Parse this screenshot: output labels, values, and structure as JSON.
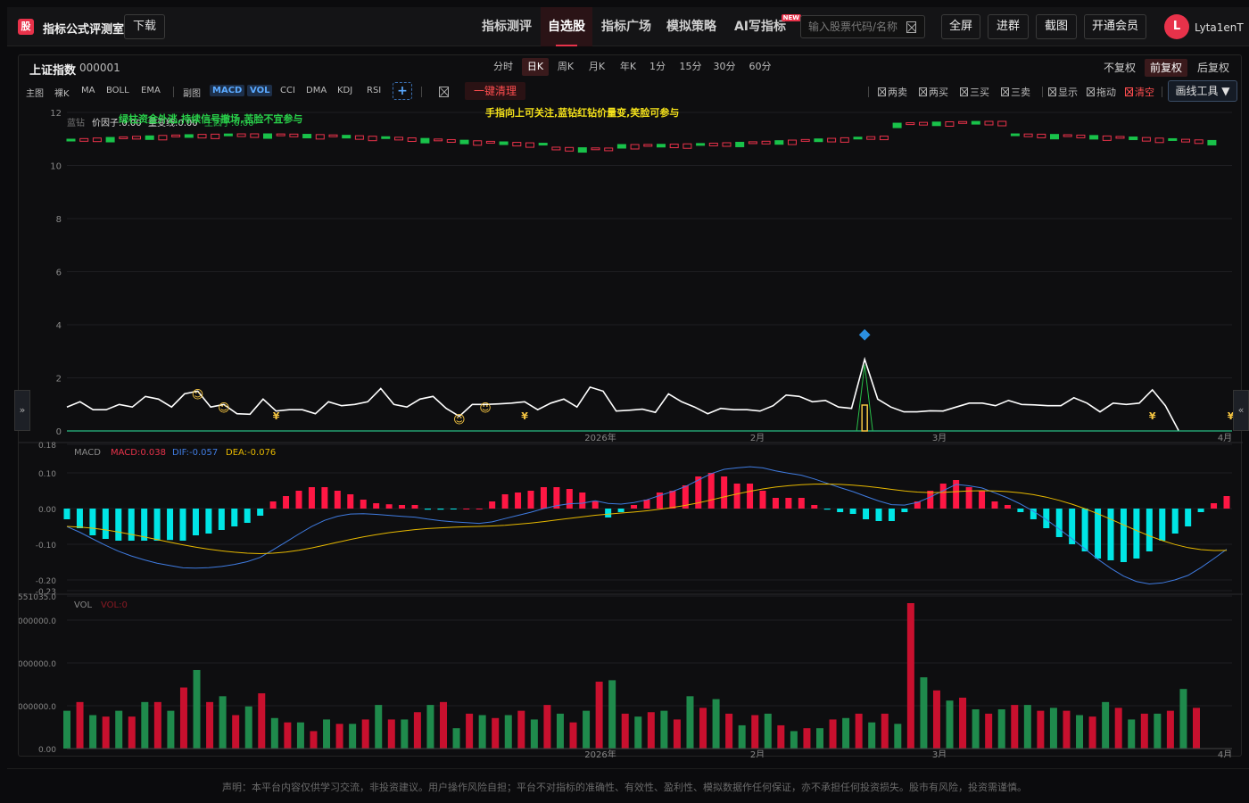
{
  "app": {
    "logo_char": "股",
    "title": "指标公式评测室",
    "download": "下载"
  },
  "nav": [
    {
      "label": "指标测评"
    },
    {
      "label": "自选股",
      "active": true
    },
    {
      "label": "指标广场"
    },
    {
      "label": "模拟策略"
    },
    {
      "label": "AI写指标",
      "badge": "NEW"
    }
  ],
  "search": {
    "placeholder": "输入股票代码/名称"
  },
  "top_buttons": [
    "全屏",
    "进群",
    "截图",
    "开通会员"
  ],
  "user": {
    "avatar": "L",
    "name": "Lyta1enT"
  },
  "stock": {
    "name": "上证指数",
    "code": "000001"
  },
  "periods": [
    "分时",
    "日K",
    "周K",
    "月K",
    "年K",
    "1分",
    "15分",
    "30分",
    "60分"
  ],
  "active_period": "日K",
  "adjust": [
    "不复权",
    "前复权",
    "后复权"
  ],
  "active_adjust": "前复权",
  "tools": {
    "main_label": "主图",
    "main": [
      "裸K",
      "MA",
      "BOLL",
      "EMA"
    ],
    "sub_label": "副图",
    "sub": [
      "MACD",
      "VOL",
      "CCI",
      "DMA",
      "KDJ",
      "RSI"
    ],
    "active_sub": [
      "MACD",
      "VOL"
    ],
    "plus": "+",
    "clear": "一键清理",
    "checks": [
      "两卖",
      "两买",
      "三买",
      "三卖",
      "显示",
      "拖动",
      "清空"
    ],
    "draw_tool": "画线工具 ▼"
  },
  "indicator_text": {
    "legend_name": "蓝钻",
    "price_factor": "价因子:0.00",
    "volume_line": "量变线:0.00",
    "green_factor": "主因子:0.00",
    "note_green": "绿柱资金外逃,持续信号撤场,苦脸不宜参与",
    "note_yellow": "手指向上可关注,蓝钻红钻价量变,笑脸可参与"
  },
  "side": {
    "left": "»",
    "right": "«"
  },
  "disclaimer": "声明：本平台内容仅供学习交流，非投资建议。用户操作风险自担；平台不对指标的准确性、有效性、盈利性、模拟数据作任何保证，亦不承担任何投资损失。股市有风险，投资需谨慎。",
  "chart_data": [
    {
      "type": "line",
      "title": "",
      "ylim": [
        0,
        12
      ],
      "y_ticks": [
        0,
        2,
        4,
        6,
        8,
        10,
        12
      ],
      "x_tick_labels": [
        "2026年",
        "2月",
        "3月",
        "4月"
      ],
      "series": [
        {
          "name": "",
          "color": "#ffffff",
          "values": [
            0.9,
            1.1,
            0.8,
            0.8,
            1.0,
            0.9,
            1.3,
            1.2,
            0.9,
            1.4,
            1.5,
            0.9,
            1.0,
            0.65,
            0.63,
            1.2,
            0.75,
            0.8,
            0.8,
            0.65,
            1.1,
            0.95,
            1.0,
            1.1,
            1.6,
            1.0,
            0.9,
            1.2,
            1.3,
            0.85,
            0.55,
            1.0,
            1.0,
            1.02,
            1.05,
            1.1,
            0.8,
            1.05,
            1.2,
            0.9,
            1.65,
            1.5,
            0.75,
            0.78,
            0.82,
            0.7,
            1.4,
            1.1,
            0.9,
            0.65,
            0.85,
            0.8,
            0.8,
            0.75,
            0.95,
            1.35,
            1.3,
            1.1,
            1.15,
            0.9,
            0.85,
            2.7,
            1.2,
            0.9,
            0.72,
            0.72,
            0.76,
            0.75,
            0.9,
            1.05,
            1.05,
            0.95,
            1.15,
            1.0,
            0.98,
            0.95,
            0.95,
            1.25,
            1.05,
            0.72,
            1.05,
            1.0,
            1.05,
            1.55,
            0.95,
            0.02
          ]
        },
        {
          "name": "",
          "color": "#f5c542",
          "style": "candles",
          "note": "price candles near top"
        }
      ],
      "markers": {
        "smile_indices": [
          10,
          12,
          30,
          32
        ],
        "yen_indices": [
          16,
          35,
          83,
          89
        ],
        "diamond_index": 61
      }
    },
    {
      "type": "bar",
      "title": "MACD",
      "labels": {
        "name": "MACD",
        "macd": "MACD:0.038",
        "dif": "DIF:-0.057",
        "dea": "DEA:-0.076"
      },
      "ylim": [
        -0.23,
        0.18
      ],
      "y_ticks": [
        0.18,
        0.1,
        0.0,
        -0.1,
        -0.2,
        -0.23
      ],
      "series": [
        {
          "name": "MACD",
          "values": [
            -0.03,
            -0.055,
            -0.075,
            -0.085,
            -0.09,
            -0.09,
            -0.09,
            -0.09,
            -0.088,
            -0.09,
            -0.075,
            -0.07,
            -0.06,
            -0.05,
            -0.04,
            -0.02,
            0.02,
            0.035,
            0.05,
            0.06,
            0.06,
            0.05,
            0.04,
            0.025,
            0.015,
            0.012,
            0.01,
            0.01,
            -0.003,
            -0.003,
            -0.001,
            0.0,
            0.0,
            0.02,
            0.04,
            0.045,
            0.05,
            0.06,
            0.06,
            0.055,
            0.045,
            0.02,
            -0.025,
            -0.01,
            0.01,
            0.025,
            0.045,
            0.05,
            0.065,
            0.09,
            0.1,
            0.09,
            0.07,
            0.07,
            0.05,
            0.03,
            0.03,
            0.03,
            0.01,
            -0.003,
            -0.01,
            -0.015,
            -0.03,
            -0.035,
            -0.035,
            -0.01,
            0.02,
            0.05,
            0.07,
            0.08,
            0.06,
            0.05,
            0.02,
            0.01,
            -0.01,
            -0.03,
            -0.055,
            -0.08,
            -0.1,
            -0.12,
            -0.14,
            -0.145,
            -0.15,
            -0.14,
            -0.12,
            -0.09,
            -0.07,
            -0.05,
            -0.01,
            0.015,
            0.035
          ],
          "colors": [
            "#00e5e5",
            "#ff1744"
          ]
        },
        {
          "name": "DIF",
          "color": "#3f7be0"
        },
        {
          "name": "DEA",
          "color": "#e6b800"
        }
      ]
    },
    {
      "type": "bar",
      "title": "VOL",
      "labels": {
        "name": "VOL",
        "vol": "VOL:0"
      },
      "y_ticks_text": [
        "551035.0",
        "000000.0",
        "000000.0",
        "000000.0",
        "0.00"
      ],
      "x_tick_labels": [
        "2026年",
        "2月",
        "3月",
        "4月"
      ],
      "series": [
        {
          "name": "VOL",
          "values": [
            0.26,
            0.32,
            0.23,
            0.22,
            0.26,
            0.22,
            0.32,
            0.32,
            0.26,
            0.42,
            0.54,
            0.32,
            0.36,
            0.23,
            0.29,
            0.38,
            0.21,
            0.18,
            0.18,
            0.12,
            0.2,
            0.17,
            0.17,
            0.2,
            0.3,
            0.2,
            0.2,
            0.25,
            0.3,
            0.32,
            0.14,
            0.24,
            0.23,
            0.21,
            0.23,
            0.26,
            0.2,
            0.3,
            0.24,
            0.18,
            0.26,
            0.46,
            0.47,
            0.24,
            0.22,
            0.25,
            0.26,
            0.2,
            0.36,
            0.28,
            0.34,
            0.24,
            0.16,
            0.23,
            0.24,
            0.16,
            0.12,
            0.14,
            0.14,
            0.2,
            0.21,
            0.24,
            0.18,
            0.24,
            0.17,
            1.0,
            0.49,
            0.4,
            0.33,
            0.35,
            0.27,
            0.24,
            0.27,
            0.3,
            0.3,
            0.26,
            0.28,
            0.26,
            0.23,
            0.22,
            0.32,
            0.28,
            0.2,
            0.24,
            0.24,
            0.26,
            0.41,
            0.28
          ],
          "colors": [
            "#1f8a4c",
            "#c8102e"
          ]
        }
      ]
    }
  ]
}
